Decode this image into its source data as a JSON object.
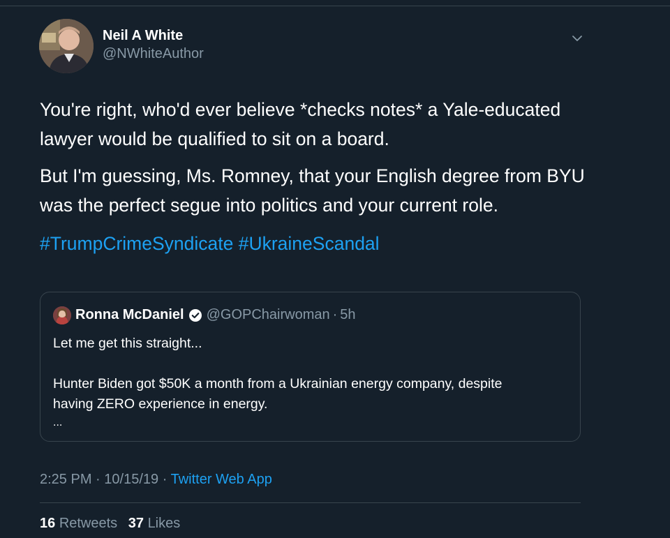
{
  "author": {
    "name": "Neil A White",
    "handle": "@NWhiteAuthor"
  },
  "tweet": {
    "paragraph1": "You're right, who'd ever believe *checks notes* a Yale-educated lawyer would be qualified to sit on a board.",
    "paragraph2": "But I'm guessing, Ms. Romney, that your English degree from BYU was the perfect segue into politics and your current role.",
    "hashtags": [
      "#TrumpCrimeSyndicate",
      "#UkraineScandal"
    ]
  },
  "quote": {
    "name": "Ronna McDaniel",
    "handle": "@GOPChairwoman",
    "separator": "·",
    "time": "5h",
    "line1": "Let me get this straight...",
    "line2": "Hunter Biden got $50K a month from a Ukrainian energy company, despite",
    "line3": "having ZERO experience in energy.",
    "ellipsis": "..."
  },
  "meta": {
    "time": "2:25 PM",
    "date": "10/15/19",
    "separator": "·",
    "source": "Twitter Web App"
  },
  "stats": {
    "retweets_count": "16",
    "retweets_label": "Retweets",
    "likes_count": "37",
    "likes_label": "Likes"
  },
  "colors": {
    "background": "#15202b",
    "accent": "#1da1f2",
    "secondary_text": "#8899a6",
    "border": "#38444d"
  },
  "icons": [
    "chevron-down-icon",
    "verified-badge-icon"
  ]
}
